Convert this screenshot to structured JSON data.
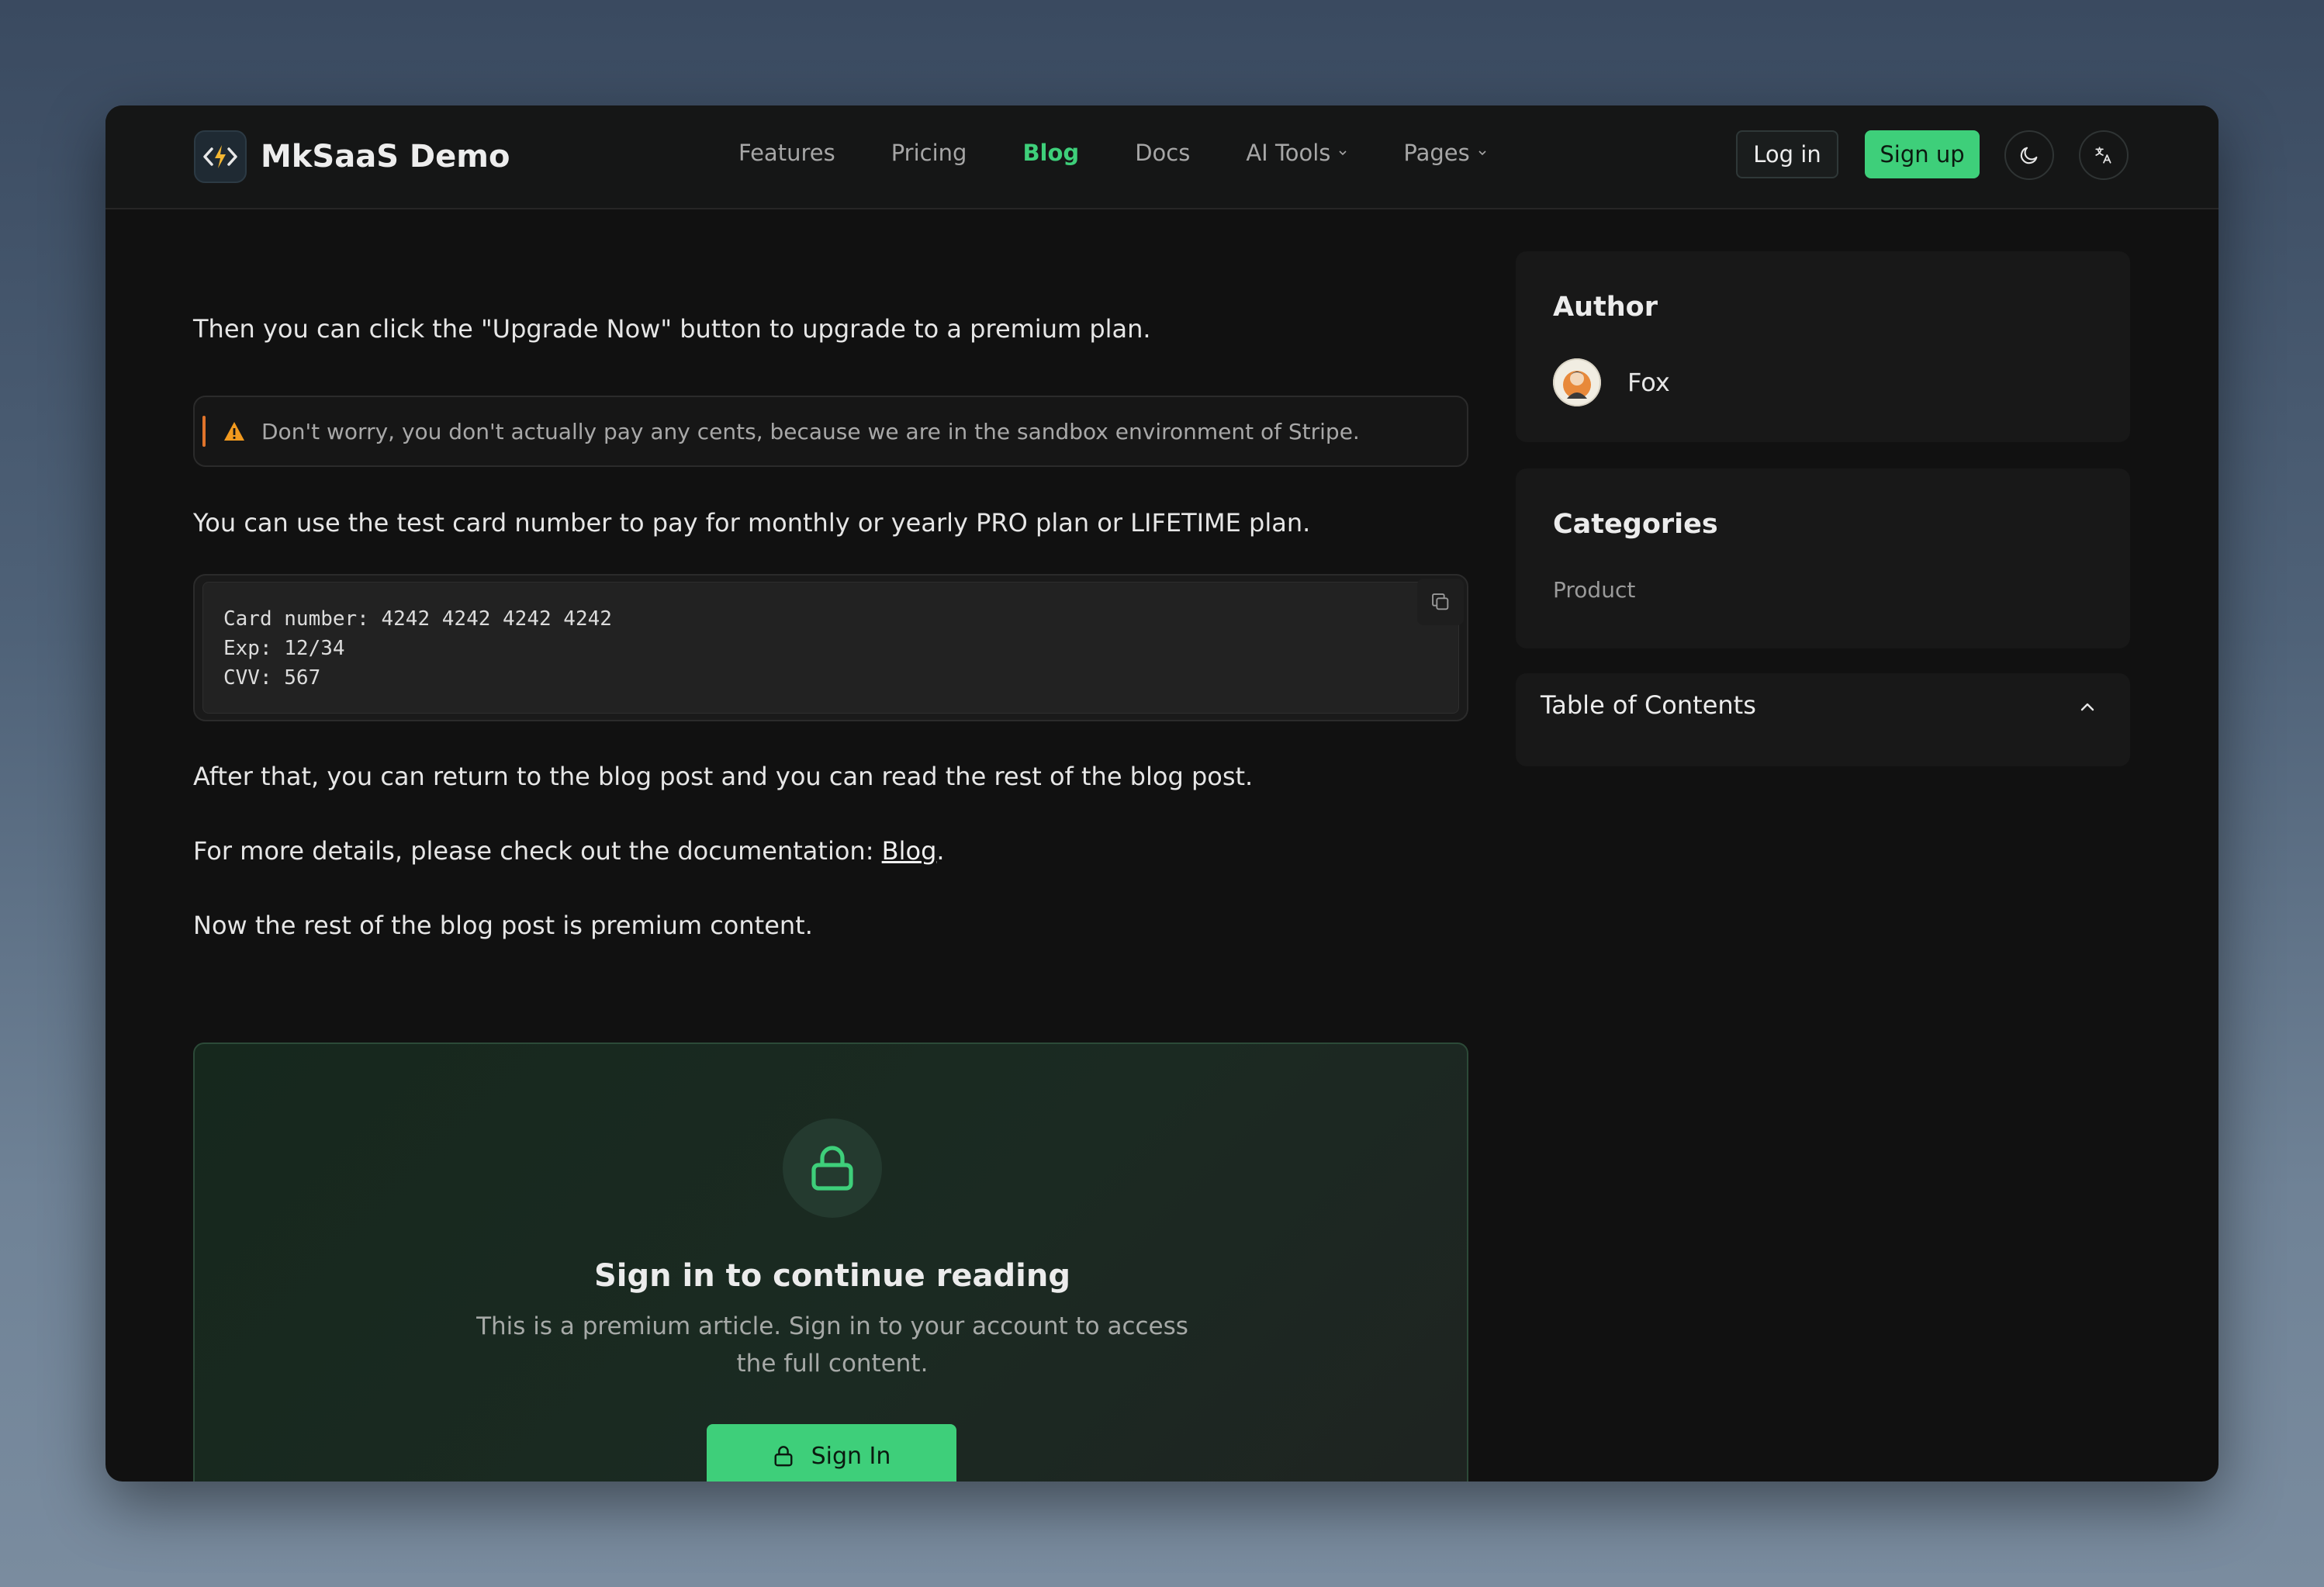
{
  "navbar": {
    "brand_name": "MkSaaS Demo",
    "links": [
      {
        "label": "Features"
      },
      {
        "label": "Pricing"
      },
      {
        "label": "Blog",
        "active": true
      },
      {
        "label": "Docs"
      },
      {
        "label": "AI Tools",
        "has_dropdown": true
      },
      {
        "label": "Pages",
        "has_dropdown": true
      }
    ],
    "login_label": "Log in",
    "signup_label": "Sign up",
    "theme_icon": "moon-icon",
    "language_icon": "translate-icon",
    "accent_color": "#3ecf7a"
  },
  "article": {
    "p1": "Then you can click the \"Upgrade Now\" button to upgrade to a premium plan.",
    "callout": "Don't worry, you don't actually pay any cents, because we are in the sandbox environment of Stripe.",
    "p2": "You can use the test card number to pay for monthly or yearly PRO plan or LIFETIME plan.",
    "code_lines": [
      "Card number: 4242 4242 4242 4242",
      "Exp: 12/34",
      "CVV: 567"
    ],
    "p3": "After that, you can return to the blog post and you can read the rest of the blog post.",
    "p4_prefix": "For more details, please check out the documentation: ",
    "p4_link": "Blog",
    "p4_suffix": ".",
    "p5": "Now the rest of the blog post is premium content."
  },
  "paywall": {
    "title": "Sign in to continue reading",
    "description_line1": "This is a premium article. Sign in to your account to access",
    "description_line2": "the full content.",
    "button_label": "Sign In"
  },
  "sidebar": {
    "author_heading": "Author",
    "author_name": "Fox",
    "categories_heading": "Categories",
    "categories": [
      "Product"
    ],
    "toc_heading": "Table of Contents"
  }
}
